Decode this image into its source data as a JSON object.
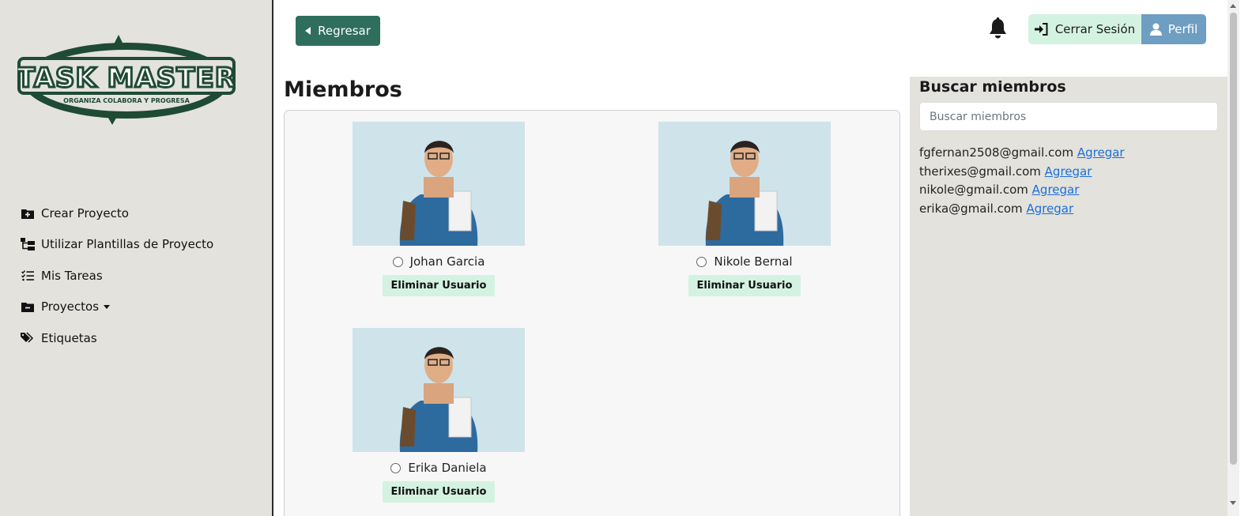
{
  "sidebar": {
    "logo": {
      "title": "TASK MASTER",
      "tagline": "ORGANIZA COLABORA Y PROGRESA",
      "color": "#1f4a33"
    },
    "items": [
      {
        "label": "Crear Proyecto",
        "icon": "folder-plus-icon"
      },
      {
        "label": "Utilizar Plantillas de Proyecto",
        "icon": "template-tree-icon"
      },
      {
        "label": "Mis Tareas",
        "icon": "task-list-icon"
      },
      {
        "label": "Proyectos",
        "icon": "folder-minus-icon",
        "has_dropdown": true
      },
      {
        "label": "Etiquetas",
        "icon": "tags-icon"
      }
    ]
  },
  "header": {
    "back_label": "Regresar",
    "logout_label": "Cerrar Sesión",
    "profile_label": "Perfil"
  },
  "main": {
    "title": "Miembros",
    "members": [
      {
        "name": "Johan Garcia",
        "remove_label": "Eliminar Usuario"
      },
      {
        "name": "Nikole Bernal",
        "remove_label": "Eliminar Usuario"
      },
      {
        "name": "Erika Daniela",
        "remove_label": "Eliminar Usuario"
      }
    ]
  },
  "search": {
    "title": "Buscar miembros",
    "placeholder": "Buscar miembros",
    "results": [
      {
        "email": "fgfernan2508@gmail.com",
        "action": "Agregar"
      },
      {
        "email": "therixes@gmail.com",
        "action": "Agregar"
      },
      {
        "email": "nikole@gmail.com",
        "action": "Agregar"
      },
      {
        "email": "erika@gmail.com",
        "action": "Agregar"
      }
    ]
  },
  "colors": {
    "sidebar_bg": "#e3e2dd",
    "primary_green": "#2f6e5c",
    "light_green": "#d4f2e1",
    "profile_blue": "#6e9ec2",
    "link_blue": "#1a6fd8"
  }
}
